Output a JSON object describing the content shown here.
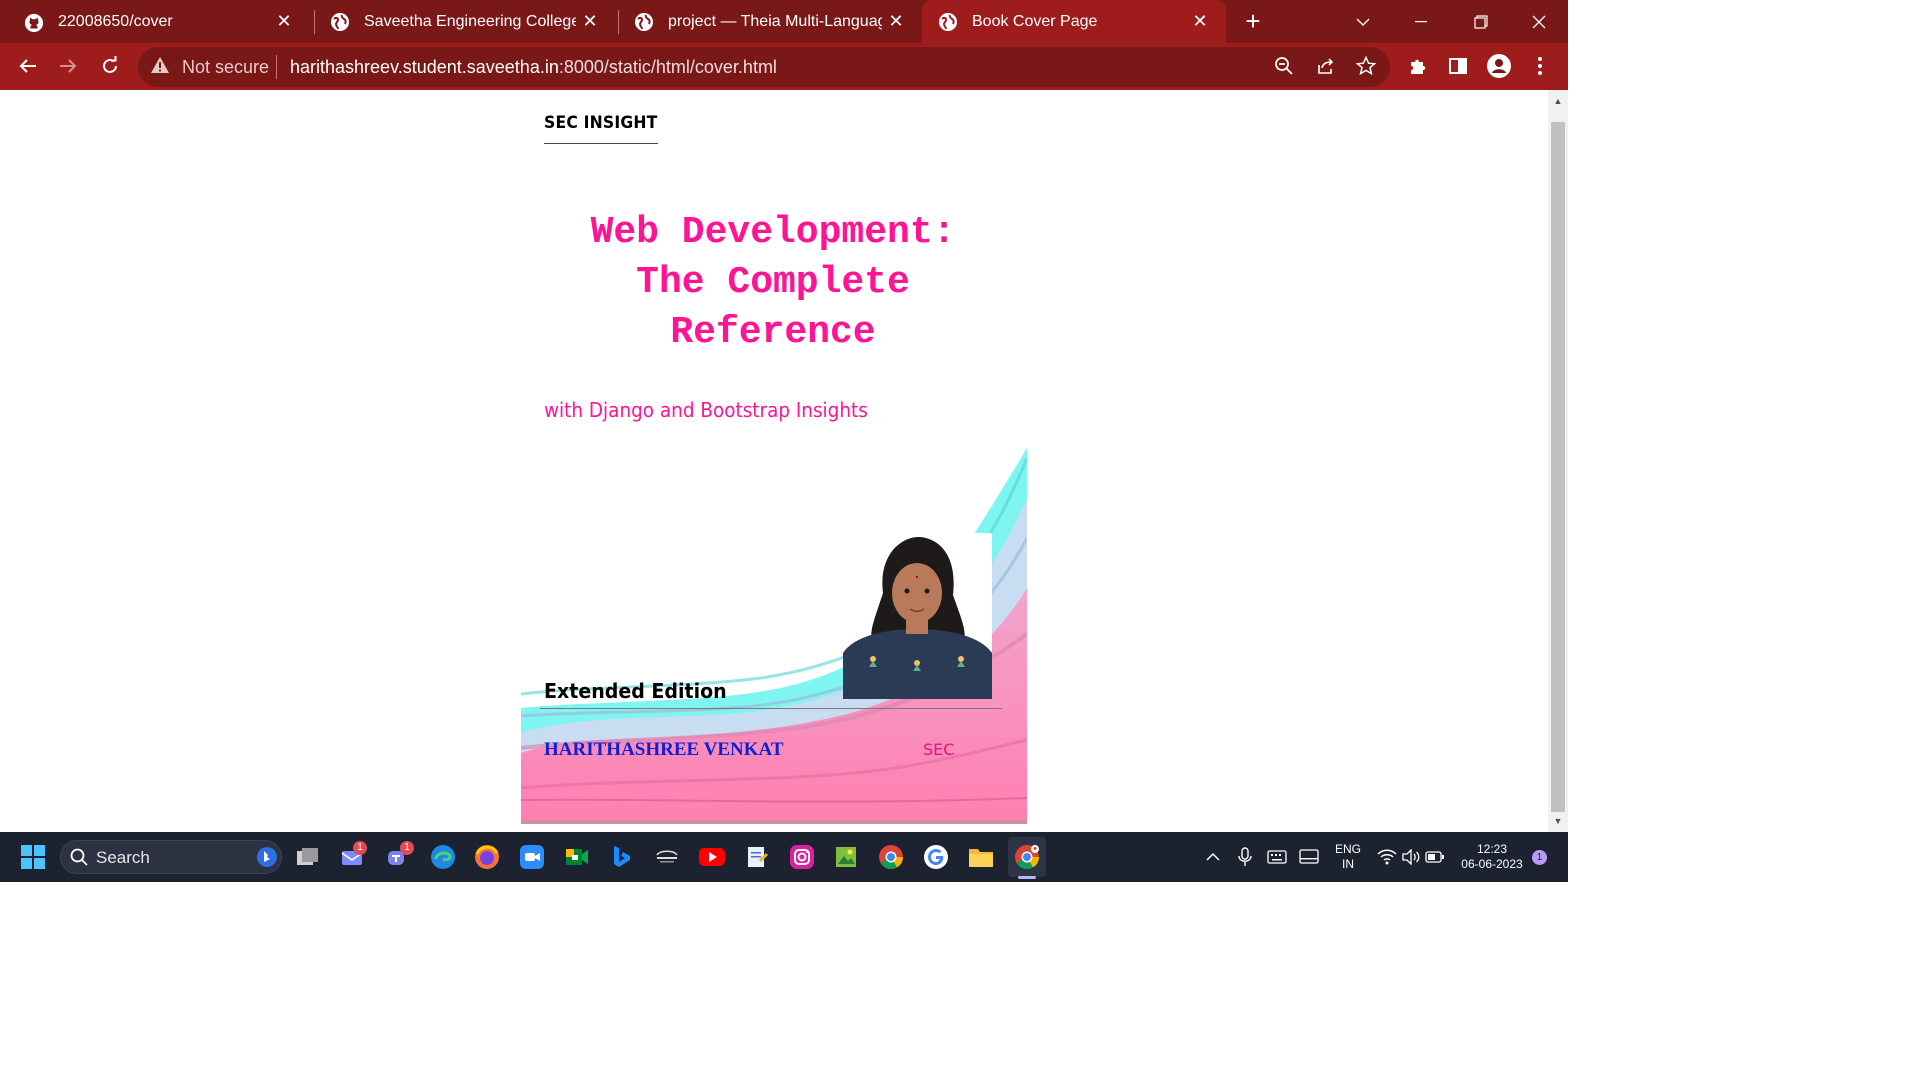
{
  "browser": {
    "tabs": [
      {
        "title": "22008650/cover",
        "favicon": "github-icon",
        "active": false
      },
      {
        "title": "Saveetha Engineering College",
        "favicon": "globe-icon",
        "active": false
      },
      {
        "title": "project — Theia Multi-Language",
        "favicon": "globe-icon",
        "active": false
      },
      {
        "title": "Book Cover Page",
        "favicon": "globe-icon",
        "active": true
      }
    ],
    "security_label": "Not secure",
    "url_host": "harithashreev.student.saveetha.in",
    "url_path": ":8000/static/html/cover.html",
    "accent_color": "#9e1c1c"
  },
  "page": {
    "brand": "SEC INSIGHT",
    "title_lines": [
      "Web Development:",
      "The Complete",
      "Reference"
    ],
    "subtitle": "with Django and Bootstrap Insights",
    "edition": "Extended Edition",
    "author": "HARITHASHREE VENKAT",
    "publisher": "SEC",
    "title_color": "#ff1493",
    "author_color": "#0a21d6"
  },
  "taskbar": {
    "search_label": "Search",
    "badges": {
      "messages": "1",
      "teams": "1",
      "notifications": "1"
    },
    "language_line1": "ENG",
    "language_line2": "IN",
    "time": "12:23",
    "date": "06-06-2023",
    "apps": [
      "windows-start-icon",
      "task-view-icon",
      "mail-icon",
      "teams-icon",
      "edge-icon",
      "firefox-icon",
      "zoom-icon",
      "meet-icon",
      "bing-icon",
      "hotstar-icon",
      "youtube-icon",
      "notepad-icon",
      "instagram-icon",
      "photos-icon",
      "chrome-icon",
      "google-icon",
      "file-explorer-icon",
      "chrome-profile-icon"
    ]
  }
}
